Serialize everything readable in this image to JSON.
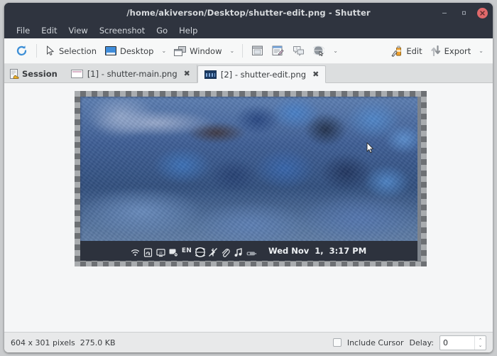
{
  "window": {
    "title": "/home/akiverson/Desktop/shutter-edit.png - Shutter",
    "minimize_label": "–",
    "maximize_label": "❐",
    "close_label": "✕"
  },
  "menubar": {
    "items": [
      {
        "label": "File"
      },
      {
        "label": "Edit"
      },
      {
        "label": "View"
      },
      {
        "label": "Screenshot"
      },
      {
        "label": "Go"
      },
      {
        "label": "Help"
      }
    ]
  },
  "toolbar": {
    "refresh_icon": "refresh-icon",
    "items": [
      {
        "label": "Selection",
        "icon": "cursor-arrow-icon"
      },
      {
        "label": "Desktop",
        "icon": "monitor-icon",
        "caret": "⌄"
      },
      {
        "label": "Window",
        "icon": "window-stack-icon",
        "caret": "⌄"
      }
    ],
    "icon_buttons": [
      {
        "icon": "menu-window-icon"
      },
      {
        "icon": "document-edit-icon"
      },
      {
        "icon": "tooltip-icon"
      },
      {
        "icon": "web-globe-icon"
      }
    ],
    "icon_caret": "⌄",
    "edit_label": "Edit",
    "export_label": "Export",
    "export_caret": "⌄"
  },
  "tabs": {
    "session_label": "Session",
    "items": [
      {
        "label": "[1] - shutter-main.png",
        "close": "✖",
        "active": false
      },
      {
        "label": "[2] - shutter-edit.png",
        "close": "✖",
        "active": true
      }
    ]
  },
  "capture": {
    "taskbar": {
      "tray_icons": [
        "wifi-icon",
        "screen-lock-icon",
        "display-sleep-icon",
        "screensaver-icon"
      ],
      "keyboard_layout": "EN",
      "more_icons": [
        "network-globe-icon",
        "bluetooth-disabled-icon",
        "clipboard-paperclip-icon",
        "music-note-icon",
        "battery-icon"
      ],
      "clock": "Wed Nov  1,  3:17 PM"
    }
  },
  "statusbar": {
    "dimensions": "604 x 301 pixels",
    "filesize": "275.0 KB",
    "include_cursor_label": "Include Cursor",
    "include_cursor_checked": false,
    "delay_label": "Delay:",
    "delay_value": "0",
    "spin_up": "⌃",
    "spin_down": "⌄"
  },
  "colors": {
    "titlebar": "#2f343f",
    "close_button": "#e0696b",
    "toolbar": "#f7f8f8",
    "tabbar": "#dcdedf",
    "statusbar": "#e8e9ea",
    "accent_blue": "#3f8ddb"
  }
}
